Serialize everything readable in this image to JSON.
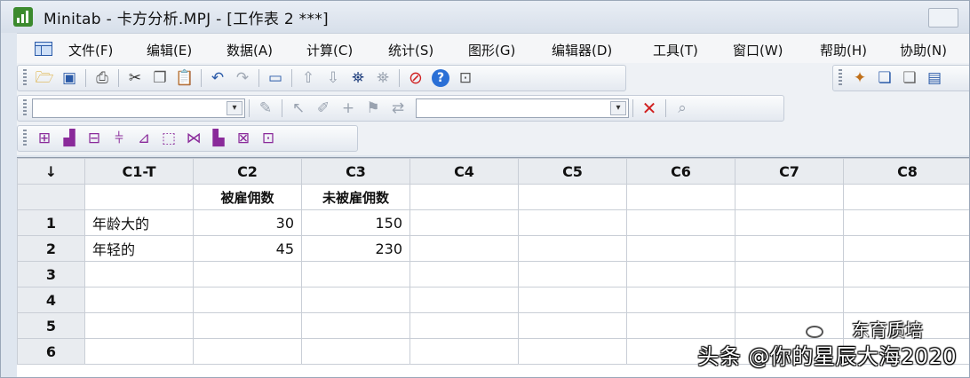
{
  "window": {
    "title": "Minitab - 卡方分析.MPJ - [工作表 2 ***]"
  },
  "menu": {
    "items": [
      "文件(F)",
      "编辑(E)",
      "数据(A)",
      "计算(C)",
      "统计(S)",
      "图形(G)",
      "编辑器(D)",
      "工具(T)",
      "窗口(W)",
      "帮助(H)",
      "协助(N)"
    ]
  },
  "icons": {
    "standard": [
      "open-folder-icon",
      "save-icon",
      "print-icon",
      "cut-icon",
      "copy-icon",
      "paste-icon",
      "undo-icon",
      "redo-icon",
      "session-window-icon",
      "scroll-up-icon",
      "scroll-down-icon",
      "find-icon",
      "replace-icon",
      "cancel-icon",
      "help-icon",
      "project-manager-icon"
    ],
    "graph_editing": [
      "brush-icon",
      "select-arrow-icon",
      "pen-icon",
      "crosshair-icon",
      "flag-icon",
      "graph-properties-icon",
      "delete-x-icon",
      "zoom-icon"
    ],
    "graphs": [
      "scatterplot-icon",
      "histogram-icon",
      "boxplot-icon",
      "interval-plot-icon",
      "matrix-plot-icon",
      "3d-plot-icon",
      "time-series-icon",
      "bar-chart-icon",
      "pareto-icon",
      "control-chart-icon"
    ],
    "right": [
      "new-graph-icon",
      "worksheet-icon",
      "tile-windows-icon",
      "info-icon"
    ]
  },
  "worksheet": {
    "corner": "↓",
    "columns": [
      "C1-T",
      "C2",
      "C3",
      "C4",
      "C5",
      "C6",
      "C7",
      "C8"
    ],
    "names": [
      "",
      "被雇佣数",
      "未被雇佣数",
      "",
      "",
      "",
      "",
      ""
    ],
    "rows": [
      {
        "id": "1",
        "cells": [
          "年龄大的",
          "30",
          "150",
          "",
          "",
          "",
          "",
          ""
        ]
      },
      {
        "id": "2",
        "cells": [
          "年轻的",
          "45",
          "230",
          "",
          "",
          "",
          "",
          ""
        ]
      },
      {
        "id": "3",
        "cells": [
          "",
          "",
          "",
          "",
          "",
          "",
          "",
          ""
        ]
      },
      {
        "id": "4",
        "cells": [
          "",
          "",
          "",
          "",
          "",
          "",
          "",
          ""
        ]
      },
      {
        "id": "5",
        "cells": [
          "",
          "",
          "",
          "",
          "",
          "",
          "",
          ""
        ]
      },
      {
        "id": "6",
        "cells": [
          "",
          "",
          "",
          "",
          "",
          "",
          "",
          ""
        ]
      }
    ]
  },
  "watermark": {
    "brand": "东育质培",
    "text": "头条 @你的星辰大海2020"
  },
  "colors": {
    "accent": "#2a5aa8",
    "cancel_red": "#d02020",
    "help_blue": "#2a6fd6",
    "graph_purple": "#8a2a9a"
  }
}
